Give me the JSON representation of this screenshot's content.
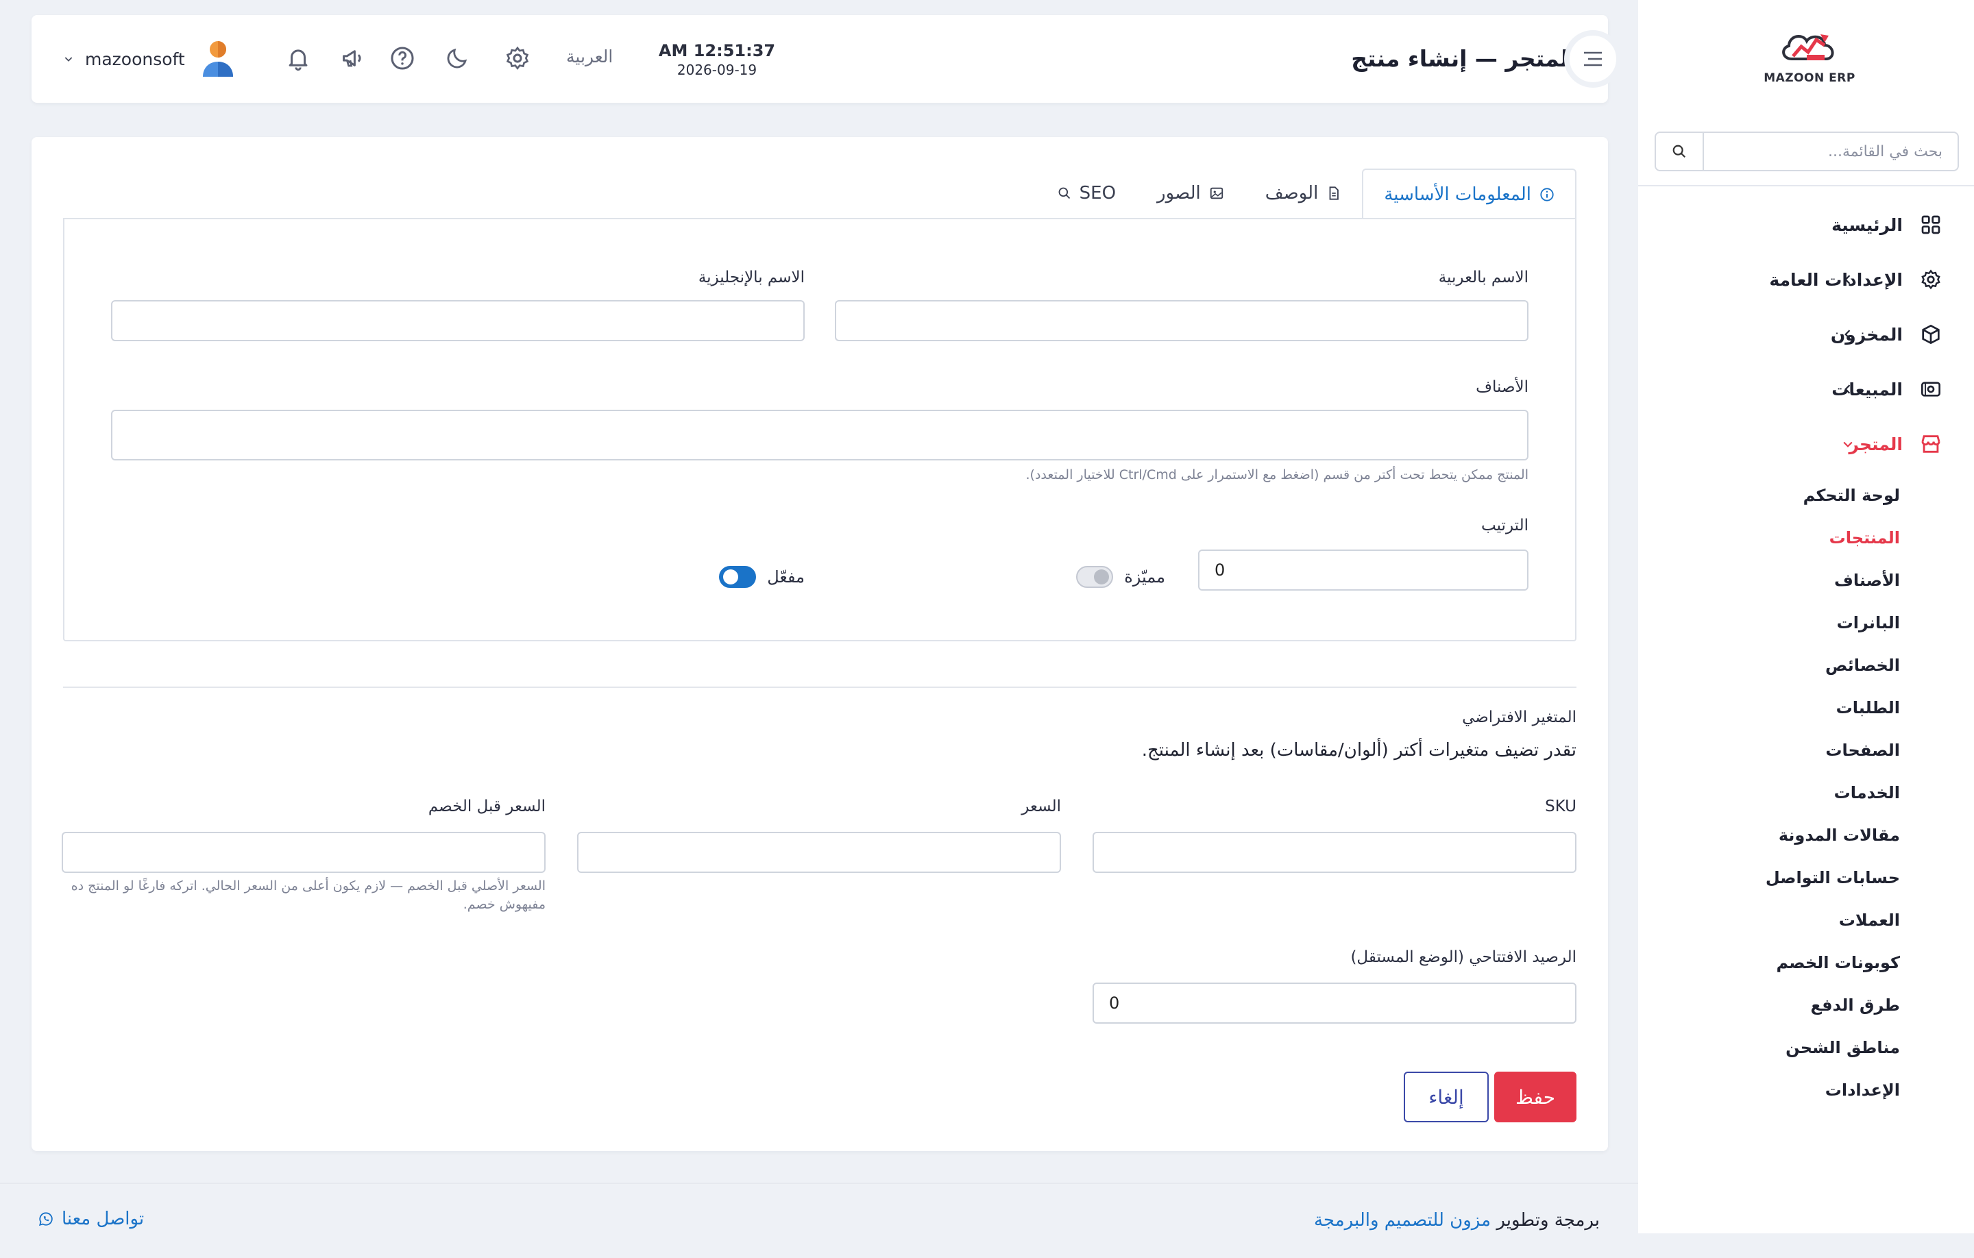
{
  "sidebar": {
    "logo_text": "MAZOON ERP",
    "search_placeholder": "بحث في القائمة...",
    "items": [
      {
        "label": "الرئيسية",
        "icon": "grid-icon",
        "has_chevron": false
      },
      {
        "label": "الإعدادات العامة",
        "icon": "gear-icon",
        "has_chevron": true
      },
      {
        "label": "المخزون",
        "icon": "box-icon",
        "has_chevron": true
      },
      {
        "label": "المبيعات",
        "icon": "cash-icon",
        "has_chevron": true
      },
      {
        "label": "المتجر",
        "icon": "store-icon",
        "has_chevron": true,
        "expanded": true
      }
    ],
    "store_sub": [
      "لوحة التحكم",
      "المنتجات",
      "الأصناف",
      "البانرات",
      "الخصائص",
      "الطلبات",
      "الصفحات",
      "الخدمات",
      "مقالات المدونة",
      "حسابات التواصل",
      "العملات",
      "كوبونات الخصم",
      "طرق الدفع",
      "مناطق الشحن",
      "الإعدادات"
    ],
    "active_sub": "المنتجات"
  },
  "topbar": {
    "title": "المتجر — إنشاء منتج",
    "time": "AM 12:51:37",
    "date": "2026-09-19",
    "language": "العربية",
    "username": "mazoonsoft"
  },
  "form": {
    "tabs": [
      {
        "label": "المعلومات الأساسية",
        "icon": "info-icon",
        "active": true
      },
      {
        "label": "الوصف",
        "icon": "document-icon",
        "active": false
      },
      {
        "label": "الصور",
        "icon": "image-icon",
        "active": false
      },
      {
        "label": "SEO",
        "icon": "search-icon",
        "active": false
      }
    ],
    "name_ar_label": "الاسم بالعربية",
    "name_ar_value": "",
    "name_en_label": "الاسم بالإنجليزية",
    "name_en_value": "",
    "categories_label": "الأصناف",
    "categories_hint": "المنتج ممكن يتحط تحت أكتر من قسم (اضغط مع الاستمرار على Ctrl/Cmd للاختيار المتعدد).",
    "order_label": "الترتيب",
    "order_value": "0",
    "featured_label": "مميّزة",
    "featured_on": false,
    "enabled_label": "مفعّل",
    "enabled_on": true,
    "variant_title": "المتغير الافتراضي",
    "variant_desc": "تقدر تضيف متغيرات أكتر (ألوان/مقاسات) بعد إنشاء المنتج.",
    "sku_label": "SKU",
    "sku_value": "",
    "price_label": "السعر",
    "price_value": "",
    "compare_price_label": "السعر قبل الخصم",
    "compare_price_value": "",
    "compare_price_hint": "السعر الأصلي قبل الخصم — لازم يكون أعلى من السعر الحالي. اتركه فارغًا لو المنتج ده مفيهوش خصم.",
    "opening_balance_label": "الرصيد الافتتاحي (الوضع المستقل)",
    "opening_balance_value": "0",
    "save_label": "حفظ",
    "cancel_label": "إلغاء"
  },
  "footer": {
    "credit_prefix": "برمجة وتطوير",
    "credit_brand": "مزون للتصميم والبرمجة",
    "contact_label": "تواصل معنا"
  },
  "colors": {
    "accent_red": "#e5384a",
    "accent_blue": "#1a73c8",
    "background": "#eef1f6"
  }
}
